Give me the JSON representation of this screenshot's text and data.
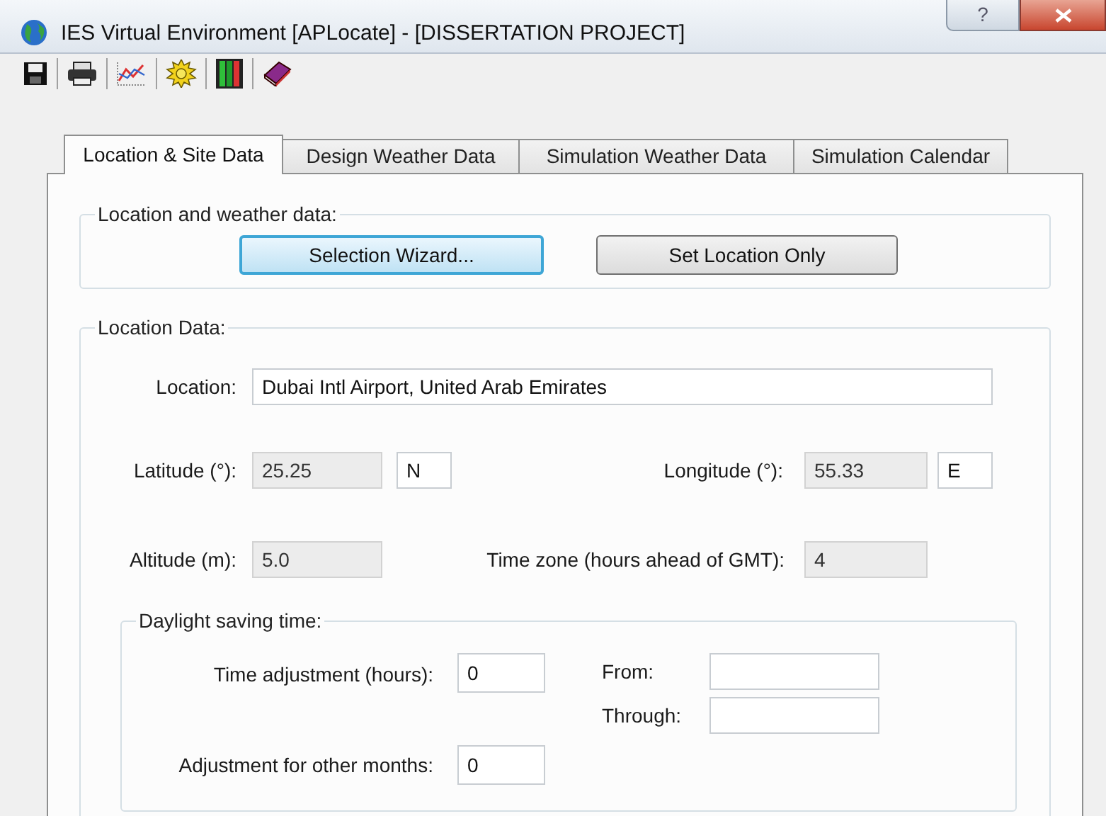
{
  "window": {
    "title": "IES Virtual Environment [APLocate] - [DISSERTATION PROJECT]",
    "help_button": "?"
  },
  "tabs": [
    {
      "label": "Location & Site Data",
      "selected": true
    },
    {
      "label": "Design Weather Data",
      "selected": false
    },
    {
      "label": "Simulation Weather Data",
      "selected": false
    },
    {
      "label": "Simulation Calendar",
      "selected": false
    }
  ],
  "weather_group": {
    "legend": "Location and weather data:",
    "buttons": [
      {
        "label": "Selection Wizard...",
        "focused": true
      },
      {
        "label": "Set Location Only",
        "focused": false
      }
    ]
  },
  "location_group": {
    "legend": "Location Data:",
    "location": {
      "label": "Location:",
      "value": "Dubai Intl Airport, United Arab Emirates",
      "readonly": false
    },
    "latitude": {
      "label": "Latitude (°):",
      "value": "25.25",
      "readonly": true,
      "hemisphere": "N"
    },
    "longitude": {
      "label": "Longitude (°):",
      "value": "55.33",
      "readonly": true,
      "hemisphere": "E"
    },
    "altitude": {
      "label": "Altitude (m):",
      "value": "5.0",
      "readonly": true
    },
    "time_zone": {
      "label": "Time zone (hours ahead of GMT):",
      "value": "4",
      "readonly": true
    },
    "daylight_group": {
      "legend": "Daylight saving time:",
      "time_adjustment": {
        "label": "Time adjustment (hours):",
        "value": "0",
        "readonly": false
      },
      "from": {
        "label": "From:",
        "readonly": false
      },
      "through": {
        "label": "Through:",
        "readonly": false
      },
      "other_months": {
        "label": "Adjustment for other months:",
        "value": "0",
        "readonly": false
      }
    }
  }
}
